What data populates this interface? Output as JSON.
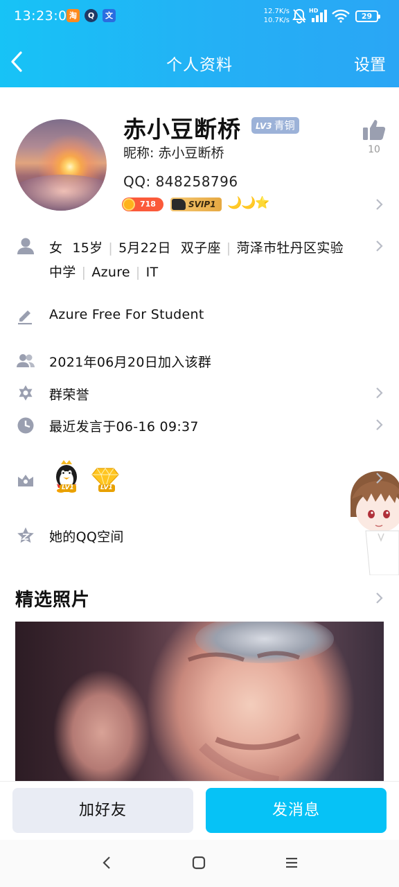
{
  "status_bar": {
    "time": "13:23:01",
    "apps": [
      {
        "icon": "taobao-app-icon",
        "glyph": "淘",
        "bg": "#ff8a1e"
      },
      {
        "icon": "qq-app-icon",
        "glyph": "Q",
        "bg": "#1f3a66"
      },
      {
        "icon": "translate-app-icon",
        "glyph": "文",
        "bg": "#2a6de0"
      }
    ],
    "net_up": "12.7K/s",
    "net_down": "10.7K/s",
    "hd_label": "HD",
    "battery": "29"
  },
  "header": {
    "title": "个人资料",
    "settings_label": "设置"
  },
  "profile": {
    "name": "赤小豆断桥",
    "level_badge_lv": "LV3",
    "level_badge_text": "青铜",
    "nickname": "昵称: 赤小豆断桥",
    "qq": "QQ: 848258796",
    "like_count": "10",
    "coin_value": "718",
    "svip_label": "SVIP1",
    "level_icons": "🌙🌙⭐"
  },
  "info": {
    "basic": {
      "gender": "女",
      "age": "15岁",
      "birthday": "5月22日",
      "zodiac": "双子座",
      "school_part1": "菏泽市牡丹区实验",
      "school_part2": "中学",
      "company": "Azure",
      "occupation": "IT"
    },
    "signature": "Azure Free For Student",
    "join_date": "2021年06月20日加入该群",
    "group_honor": "群荣誉",
    "last_speak": "最近发言于06-16 09:37",
    "badge_levels": [
      "LV1",
      "LV1"
    ],
    "qzone": "她的QQ空间"
  },
  "photos": {
    "title": "精选照片"
  },
  "actions": {
    "add_friend": "加好友",
    "send_message": "发消息"
  },
  "colors": {
    "header_gradient_start": "#17c3f6",
    "header_gradient_end": "#2aa6f5",
    "primary_button": "#06c2f6",
    "secondary_button": "#e9ecf4",
    "icon_gray": "#9a9fb0"
  }
}
